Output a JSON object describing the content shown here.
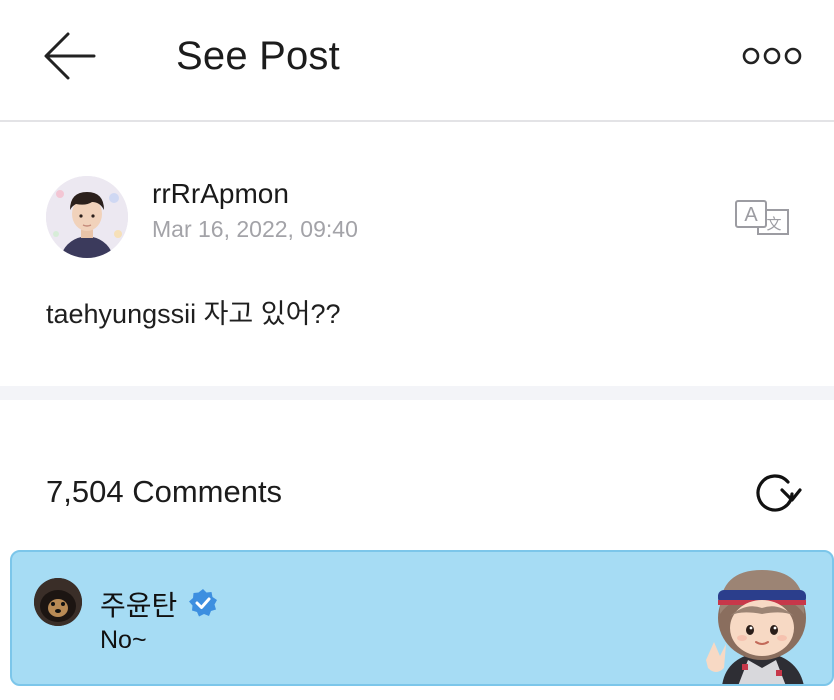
{
  "header": {
    "title": "See Post",
    "back_icon": "arrow-left-icon",
    "more_icon": "more-dots-icon"
  },
  "post": {
    "author": "rrRrApmon",
    "date": "Mar 16, 2022, 09:40",
    "text": "taehyungssii 자고 있어??",
    "translate_icon": "translate-icon"
  },
  "comments": {
    "count_label": "7,504 Comments",
    "refresh_icon": "refresh-icon",
    "items": [
      {
        "author": "주윤탄",
        "text": "No~",
        "verified": true,
        "verified_icon": "verified-badge-icon",
        "highlight_color": "#a6dcf4"
      }
    ]
  },
  "colors": {
    "accent_blue": "#3d8fe0",
    "date_gray": "#a3a3a8",
    "card_bg": "#a6dcf4"
  }
}
